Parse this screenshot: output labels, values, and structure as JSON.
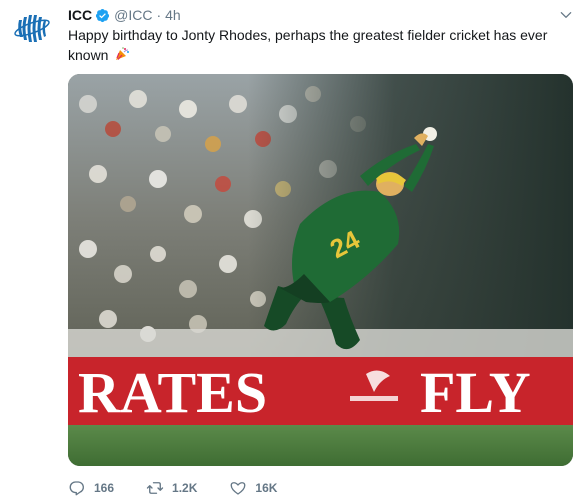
{
  "tweet": {
    "name": "ICC",
    "handle": "@ICC",
    "separator": "·",
    "time": "4h",
    "text": "Happy birthday to Jonty Rhodes, perhaps the greatest fielder cricket has ever known",
    "emoji": "party-popper-icon",
    "verified": true
  },
  "media": {
    "banner_left": "RATES",
    "banner_right": "FLY",
    "shirt_number": "24"
  },
  "actions": {
    "replies": "166",
    "retweets": "1.2K",
    "likes": "16K"
  },
  "colors": {
    "verified_blue": "#1da1f2",
    "secondary_text": "#657786",
    "banner_red": "#c8242b",
    "jersey_green": "#1f6b35"
  }
}
